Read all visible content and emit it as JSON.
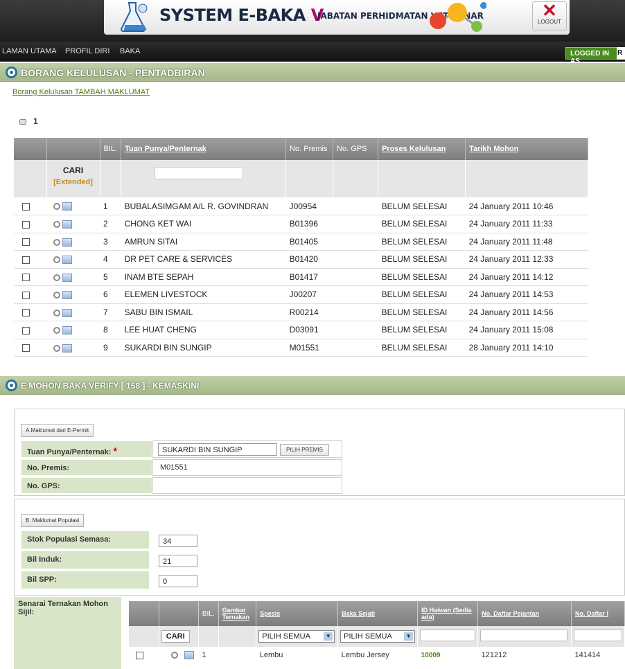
{
  "header": {
    "title": "SYSTEM E-BAKA",
    "title_mark": "V",
    "dept": "JABATAN PERHIDMATAN VETERINAR",
    "logout": "LOGOUT"
  },
  "nav": {
    "items": [
      "LAMAN UTAMA",
      "PROFIL DIRI",
      "BAKA"
    ],
    "logged_in": "LOGGED IN AS",
    "logged_in_user": "R"
  },
  "section1": {
    "title": "BORANG KELULUSAN - PENTADBIRAN",
    "link": "Borang Kelulusan TAMBAH MAKLUMAT",
    "page": "1"
  },
  "grid": {
    "headers": [
      "BIL.",
      "Tuan Punya/Penternak",
      "No. Premis",
      "No. GPS",
      "Proses Kelulusan",
      "Tarikh Mohon"
    ],
    "search": "CARI",
    "extended": "[Extended]",
    "rows": [
      {
        "bil": "1",
        "name": "BUBALASIMGAM A/L R. GOVINDRAN",
        "premis": "J00954",
        "status": "BELUM SELESAI",
        "date": "24 January 2011 10:46"
      },
      {
        "bil": "2",
        "name": "CHONG KET WAI",
        "premis": "B01396",
        "status": "BELUM SELESAI",
        "date": "24 January 2011 11:33"
      },
      {
        "bil": "3",
        "name": "AMRUN SITAI",
        "premis": "B01405",
        "status": "BELUM SELESAI",
        "date": "24 January 2011 11:48"
      },
      {
        "bil": "4",
        "name": "DR PET CARE & SERVICES",
        "premis": "B01420",
        "status": "BELUM SELESAI",
        "date": "24 January 2011 12:33"
      },
      {
        "bil": "5",
        "name": "INAM BTE SEPAH",
        "premis": "B01417",
        "status": "BELUM SELESAI",
        "date": "24 January 2011 14:12"
      },
      {
        "bil": "6",
        "name": "ELEMEN LIVESTOCK",
        "premis": "J00207",
        "status": "BELUM SELESAI",
        "date": "24 January 2011 14:53"
      },
      {
        "bil": "7",
        "name": "SABU BIN ISMAIL",
        "premis": "R00214",
        "status": "BELUM SELESAI",
        "date": "24 January 2011 14:56"
      },
      {
        "bil": "8",
        "name": "LEE HUAT CHENG",
        "premis": "D03091",
        "status": "BELUM SELESAI",
        "date": "24 January 2011 15:08"
      },
      {
        "bil": "9",
        "name": "SUKARDI BIN SUNGIP",
        "premis": "M01551",
        "status": "BELUM SELESAI",
        "date": "28 January 2011 14:10"
      }
    ]
  },
  "section2": {
    "title": "E MOHON BAKA VERIFY [ 158 ] - KEMASKINI",
    "tab_a": "A.Maklumat dari E-Permit",
    "owner_label": "Tuan Punya/Penternak:",
    "required": "*",
    "owner_value": "SUKARDI BIN SUNGIP",
    "pick_btn": "PILIH PREMIS",
    "premis_label": "No. Premis:",
    "premis_value": "M01551",
    "gps_label": "No. GPS:",
    "gps_value": "",
    "tab_b": "B. Maklumat Populasi",
    "stok_label": "Stok Populasi Semasa:",
    "stok_value": "34",
    "induk_label": "Bil Induk:",
    "induk_value": "21",
    "spp_label": "Bil SPP:",
    "spp_value": "0",
    "senarai_label": "Senarai Ternakan Mohon Sijil:"
  },
  "grid2": {
    "headers": [
      "BIL.",
      "Gambar Ternakan",
      "Spesis",
      "Baka Sejati",
      "ID Haiwan (Sedia ada)",
      "No. Daftar Pejantan",
      "No. Daftar I"
    ],
    "search": "CARI",
    "select_all_1": "PILIH SEMUA",
    "select_all_2": "PILIH SEMUA",
    "row": {
      "bil": "1",
      "spesis": "Lembu",
      "baka": "Lembu Jersey",
      "id": "10009",
      "pejantan": "121212",
      "daftar": "141414"
    }
  }
}
